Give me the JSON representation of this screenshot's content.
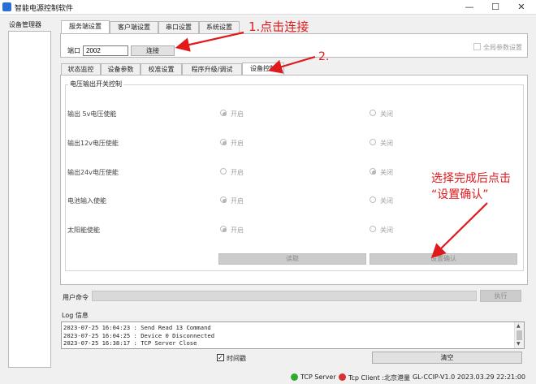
{
  "window": {
    "title": "智能电源控制软件",
    "minimize": "—",
    "maximize": "☐",
    "close": "✕"
  },
  "device_manager": {
    "label": "设备管理器"
  },
  "top_tabs": [
    {
      "label": "服务端设置"
    },
    {
      "label": "客户端设置"
    },
    {
      "label": "串口设置"
    },
    {
      "label": "系统设置"
    }
  ],
  "connection": {
    "port_label": "端口",
    "port_value": "2002",
    "connect_button": "连接",
    "global_param_label": "全局参数设置"
  },
  "sub_tabs": [
    {
      "label": "状态监控"
    },
    {
      "label": "设备参数"
    },
    {
      "label": "校准设置"
    },
    {
      "label": "程序升级/调试"
    },
    {
      "label": "设备控制"
    }
  ],
  "switch_group": {
    "title": "电压输出开关控制",
    "on_label": "开启",
    "off_label": "关闭",
    "rows": [
      {
        "label": "输出 5v电压使能",
        "state": "on"
      },
      {
        "label": "输出12v电压使能",
        "state": "on"
      },
      {
        "label": "输出24v电压使能",
        "state": "off"
      },
      {
        "label": "电池输入使能",
        "state": "on"
      },
      {
        "label": "太阳能使能",
        "state": "on"
      }
    ],
    "read_button": "读取",
    "confirm_button": "设置确认"
  },
  "command": {
    "label": "用户命令",
    "execute_button": "执行"
  },
  "log": {
    "label": "Log 信息",
    "lines": [
      "2023-07-25 16:04:23 : Send Read 13 Command",
      "2023-07-25 16:04:25 : Device 0 Disconnected",
      "2023-07-25 16:38:17 : TCP Server Close"
    ],
    "timestamp_label": "时间戳",
    "timestamp_checked": true,
    "clear_button": "清空"
  },
  "status_bar": {
    "tcp_server": "TCP Server",
    "tcp_client": "Tcp Client :北京港量",
    "version": "GL-CCIP-V1.0 2023.03.29 22:21:00",
    "server_color": "#2eaa2e",
    "client_color": "#d93030"
  },
  "annotations": {
    "step1": "1.点击连接",
    "step2": "2.",
    "step3_line1": "选择完成后点击",
    "step3_line2": "“设置确认”"
  },
  "colors": {
    "annotation": "#e0191d",
    "disabled_button": "#cccccc"
  }
}
